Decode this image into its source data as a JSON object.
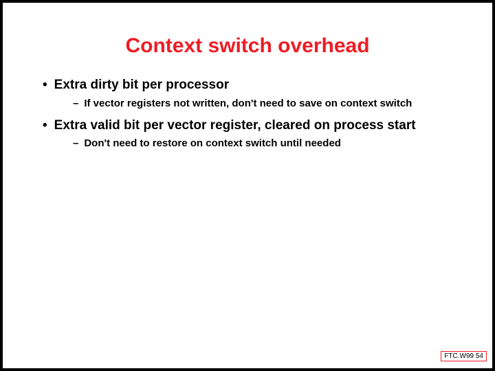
{
  "title": "Context switch overhead",
  "bullets": {
    "b1": "Extra dirty bit per processor",
    "b1_sub1": "If vector registers not written, don't need to save on context switch",
    "b2": "Extra valid  bit per vector register, cleared on process start",
    "b2_sub1": "Don't need to restore on context switch until needed"
  },
  "footer": "FTC.W99 54"
}
